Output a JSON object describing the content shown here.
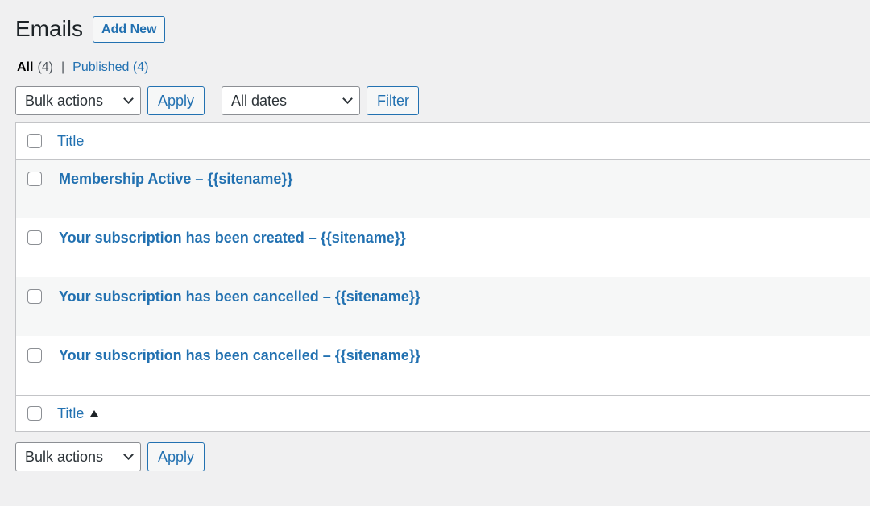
{
  "page": {
    "title": "Emails",
    "add_new_label": "Add New"
  },
  "views": {
    "all_label": "All",
    "all_count": "(4)",
    "separator": "|",
    "published_label": "Published",
    "published_count": "(4)"
  },
  "tablenav_top": {
    "bulk_actions": "Bulk actions",
    "apply_label": "Apply",
    "dates_filter": "All dates",
    "filter_label": "Filter"
  },
  "tablenav_bottom": {
    "bulk_actions": "Bulk actions",
    "apply_label": "Apply"
  },
  "table": {
    "header_title": "Title",
    "footer_title": "Title",
    "rows": [
      {
        "title": "Membership Active – {{sitename}}"
      },
      {
        "title": "Your subscription has been created – {{sitename}}"
      },
      {
        "title": "Your subscription has been cancelled – {{sitename}}"
      },
      {
        "title": "Your subscription has been cancelled – {{sitename}}"
      }
    ]
  },
  "colors": {
    "accent": "#2271b1",
    "background": "#f0f0f1",
    "row_alt": "#f6f7f7",
    "border": "#c3c4c7"
  }
}
